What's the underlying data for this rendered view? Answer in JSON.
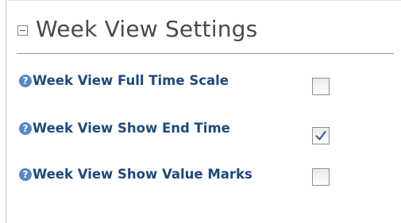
{
  "section": {
    "title": "Week View Settings",
    "collapse_icon": "minus-box-icon"
  },
  "settings": [
    {
      "label": "Week View Full Time Scale",
      "checked": false
    },
    {
      "label": "Week View Show End Time",
      "checked": true
    },
    {
      "label": "Week View Show Value Marks",
      "checked": false
    }
  ],
  "help_icon": {
    "glyph": "?",
    "name": "help-icon"
  },
  "colors": {
    "label": "#1f4a7a",
    "help_icon": "#5a88c0",
    "checkmark": "#3a5f9a",
    "title": "#4a4a4a"
  }
}
